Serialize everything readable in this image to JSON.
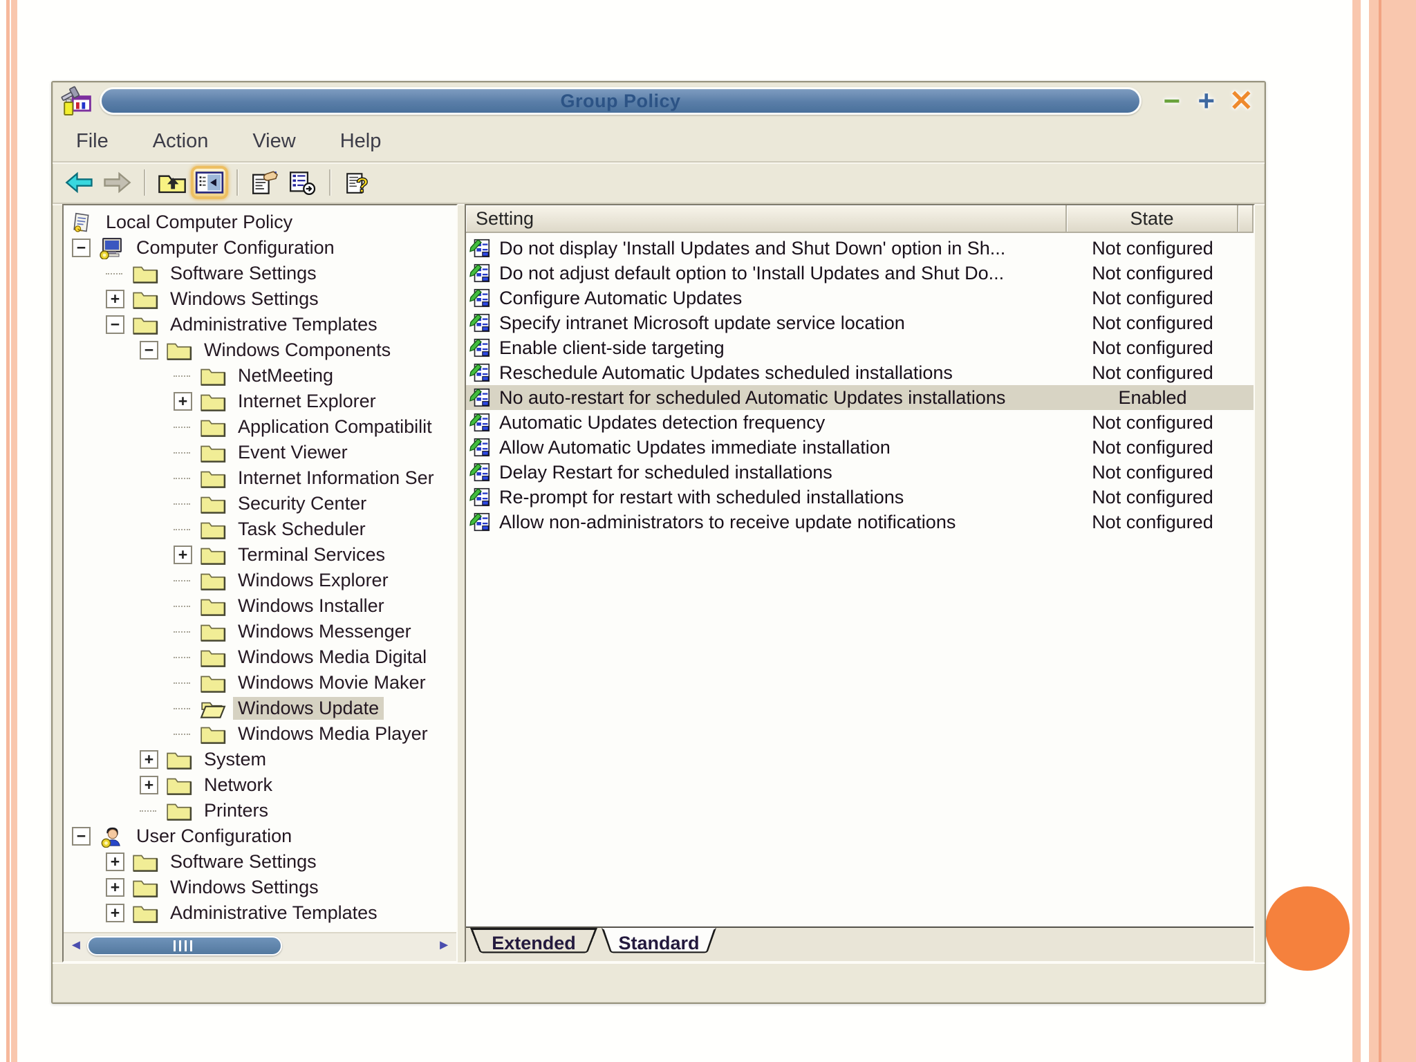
{
  "slide": {
    "background_color": "#fffffd",
    "stripe_color": "#f9c7ae",
    "accent_circle_color": "#f5813d"
  },
  "window": {
    "title": "Group Policy",
    "title_icon": "group-policy-icon",
    "controls": [
      {
        "name": "minimize-button",
        "glyph": "−",
        "color": "#69a23b"
      },
      {
        "name": "maximize-button",
        "glyph": "+",
        "color": "#3f69a0"
      },
      {
        "name": "close-button",
        "glyph": "✕",
        "color": "#ee8a2e"
      }
    ],
    "menu": {
      "items": [
        "File",
        "Action",
        "View",
        "Help"
      ]
    },
    "toolbar": {
      "items": [
        {
          "name": "back-button",
          "icon": "back-arrow-icon",
          "symbol": "back"
        },
        {
          "name": "forward-button",
          "icon": "forward-arrow-icon",
          "symbol": "forward",
          "disabled": true
        },
        {
          "type": "separator"
        },
        {
          "name": "up-one-level-button",
          "icon": "up-folder-icon",
          "symbol": "upfolder"
        },
        {
          "name": "show-hide-console-tree-button",
          "icon": "console-tree-icon",
          "symbol": "panes",
          "active": true
        },
        {
          "type": "separator"
        },
        {
          "name": "properties-button",
          "icon": "properties-icon",
          "symbol": "props"
        },
        {
          "name": "export-list-button",
          "icon": "export-list-icon",
          "symbol": "export"
        },
        {
          "type": "separator"
        },
        {
          "name": "help-button",
          "icon": "help-icon",
          "symbol": "help"
        }
      ]
    },
    "tree": {
      "items": [
        {
          "level": 0,
          "icon": "scroll",
          "label": "Local Computer Policy"
        },
        {
          "level": 1,
          "expand": "-",
          "icon": "computer",
          "label": "Computer Configuration"
        },
        {
          "level": 2,
          "icon": "folder",
          "label": "Software Settings"
        },
        {
          "level": 2,
          "expand": "+",
          "icon": "folder",
          "label": "Windows Settings"
        },
        {
          "level": 2,
          "expand": "-",
          "icon": "folder",
          "label": "Administrative Templates"
        },
        {
          "level": 3,
          "expand": "-",
          "icon": "folder",
          "label": "Windows Components"
        },
        {
          "level": 4,
          "icon": "folder",
          "label": "NetMeeting"
        },
        {
          "level": 4,
          "expand": "+",
          "icon": "folder",
          "label": "Internet Explorer"
        },
        {
          "level": 4,
          "icon": "folder",
          "label": "Application Compatibilit"
        },
        {
          "level": 4,
          "icon": "folder",
          "label": "Event Viewer"
        },
        {
          "level": 4,
          "icon": "folder",
          "label": "Internet Information Ser"
        },
        {
          "level": 4,
          "icon": "folder",
          "label": "Security Center"
        },
        {
          "level": 4,
          "icon": "folder",
          "label": "Task Scheduler"
        },
        {
          "level": 4,
          "expand": "+",
          "icon": "folder",
          "label": "Terminal Services"
        },
        {
          "level": 4,
          "icon": "folder",
          "label": "Windows Explorer"
        },
        {
          "level": 4,
          "icon": "folder",
          "label": "Windows Installer"
        },
        {
          "level": 4,
          "icon": "folder",
          "label": "Windows Messenger"
        },
        {
          "level": 4,
          "icon": "folder",
          "label": "Windows Media Digital"
        },
        {
          "level": 4,
          "icon": "folder",
          "label": "Windows Movie Maker"
        },
        {
          "level": 4,
          "icon": "folder-open",
          "label": "Windows Update",
          "selected": true
        },
        {
          "level": 4,
          "icon": "folder",
          "label": "Windows Media Player"
        },
        {
          "level": 3,
          "expand": "+",
          "icon": "folder",
          "label": "System"
        },
        {
          "level": 3,
          "expand": "+",
          "icon": "folder",
          "label": "Network"
        },
        {
          "level": 3,
          "icon": "folder",
          "label": "Printers"
        },
        {
          "level": 1,
          "expand": "-",
          "icon": "user",
          "label": "User Configuration"
        },
        {
          "level": 2,
          "expand": "+",
          "icon": "folder",
          "label": "Software Settings"
        },
        {
          "level": 2,
          "expand": "+",
          "icon": "folder",
          "label": "Windows Settings"
        },
        {
          "level": 2,
          "expand": "+",
          "icon": "folder",
          "label": "Administrative Templates"
        }
      ]
    },
    "list": {
      "columns": [
        "Setting",
        "State"
      ],
      "row_icon": "policy-setting-icon",
      "rows": [
        {
          "setting": "Do not display 'Install Updates and Shut Down' option in Sh...",
          "state": "Not configured"
        },
        {
          "setting": "Do not adjust default option to 'Install Updates and Shut Do...",
          "state": "Not configured"
        },
        {
          "setting": "Configure Automatic Updates",
          "state": "Not configured"
        },
        {
          "setting": "Specify intranet Microsoft update service location",
          "state": "Not configured"
        },
        {
          "setting": "Enable client-side targeting",
          "state": "Not configured"
        },
        {
          "setting": "Reschedule Automatic Updates scheduled installations",
          "state": "Not configured"
        },
        {
          "setting": "No auto-restart for scheduled Automatic Updates installations",
          "state": "Enabled",
          "highlighted": true
        },
        {
          "setting": "Automatic Updates detection frequency",
          "state": "Not configured"
        },
        {
          "setting": "Allow Automatic Updates immediate installation",
          "state": "Not configured"
        },
        {
          "setting": "Delay Restart for scheduled installations",
          "state": "Not configured"
        },
        {
          "setting": "Re-prompt for restart with scheduled installations",
          "state": "Not configured"
        },
        {
          "setting": "Allow non-administrators to receive update notifications",
          "state": "Not configured"
        }
      ],
      "highlight_color": "#d8d4c4"
    },
    "tabs": [
      {
        "label": "Extended",
        "active": false
      },
      {
        "label": "Standard",
        "active": true
      }
    ]
  }
}
